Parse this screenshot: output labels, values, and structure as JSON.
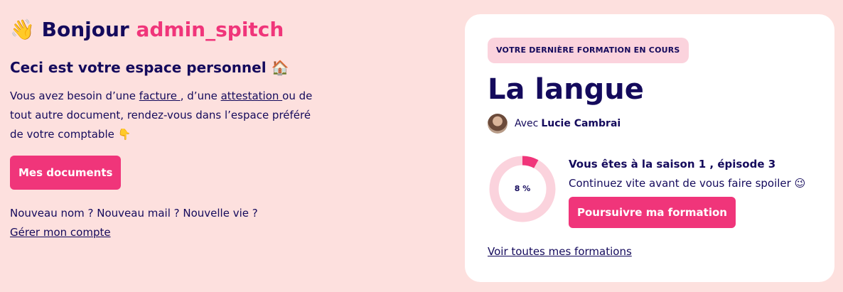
{
  "greeting": {
    "emoji": "👋",
    "prefix": "Bonjour",
    "username": "admin_spitch"
  },
  "subtitle": "Ceci est votre espace personnel 🏠",
  "intro": {
    "part1": "Vous avez besoin d’une ",
    "link_facture": "facture ",
    "part2": ", d’une ",
    "link_attestation": "attestation ",
    "part3": "ou de tout autre document, rendez-vous dans l’espace préféré de votre comptable 👇"
  },
  "documents_button": "Mes documents",
  "account": {
    "question": "Nouveau nom ? Nouveau mail ? Nouvelle vie ?",
    "manage_link": "Gérer mon compte"
  },
  "course_card": {
    "tag": "VOTRE DERNIÈRE FORMATION EN COURS",
    "title": "La langue",
    "teacher_prefix": "Avec",
    "teacher_name": "Lucie Cambrai",
    "progress_percent": 8,
    "progress_label": "8 %",
    "progress_bold": "Vous êtes à la saison 1 , épisode 3",
    "progress_rest": " Continuez vite avant de vous faire spoiler 😉",
    "continue_button": "Poursuivre ma formation",
    "all_link": "Voir toutes mes formations"
  },
  "colors": {
    "background": "#fde0de",
    "accent": "#f0357a",
    "text": "#140a5c",
    "tag_bg": "#fbd3dd",
    "ring_track": "#fbd3dd"
  }
}
